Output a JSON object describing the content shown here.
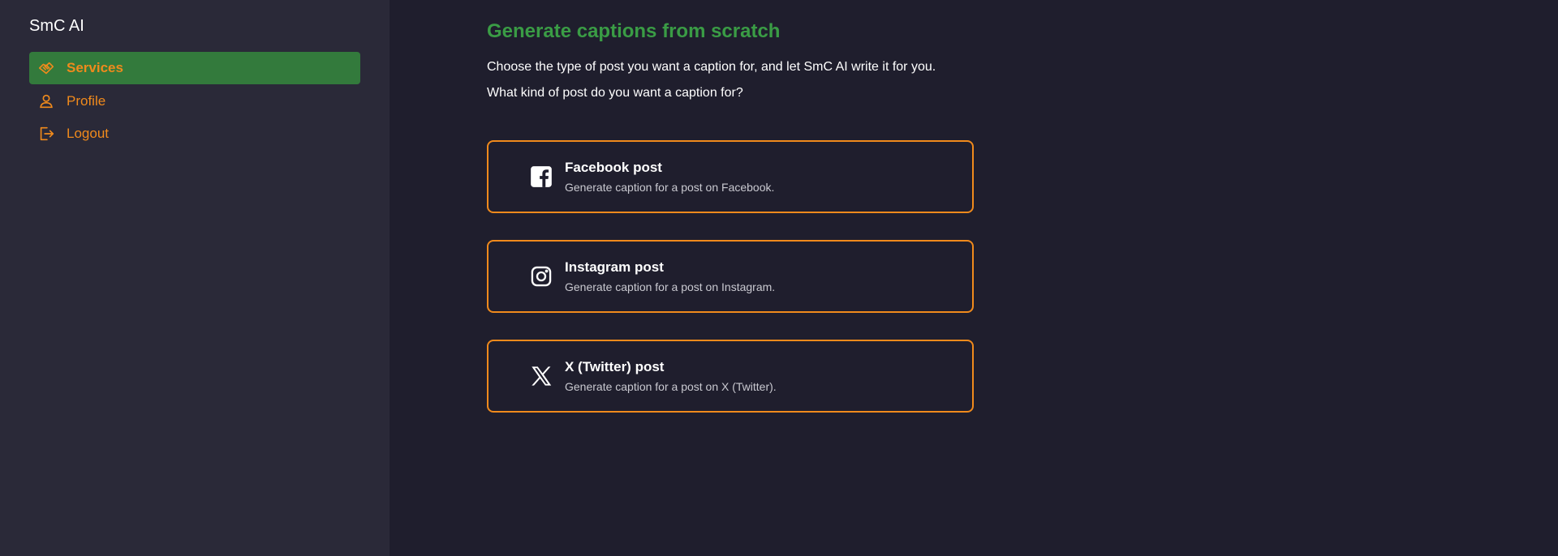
{
  "app": {
    "name": "SmC AI"
  },
  "sidebar": {
    "items": [
      {
        "label": "Services",
        "icon": "handshake-icon",
        "active": true
      },
      {
        "label": "Profile",
        "icon": "user-icon",
        "active": false
      },
      {
        "label": "Logout",
        "icon": "logout-icon",
        "active": false
      }
    ]
  },
  "main": {
    "title": "Generate captions from scratch",
    "intro": "Choose the type of post you want a caption for, and let SmC AI write it for you.",
    "question": "What kind of post do you want a caption for?",
    "cards": [
      {
        "title": "Facebook post",
        "description": "Generate caption for a post on Facebook.",
        "icon": "facebook-icon"
      },
      {
        "title": "Instagram post",
        "description": "Generate caption for a post on Instagram.",
        "icon": "instagram-icon"
      },
      {
        "title": "X (Twitter) post",
        "description": "Generate caption for a post on X (Twitter).",
        "icon": "x-twitter-icon"
      }
    ]
  },
  "colors": {
    "accent": "#f08a1c",
    "active_nav": "#337a3c",
    "title_green": "#3a9c45",
    "sidebar_bg": "#2a2938",
    "main_bg": "#1f1e2d"
  }
}
